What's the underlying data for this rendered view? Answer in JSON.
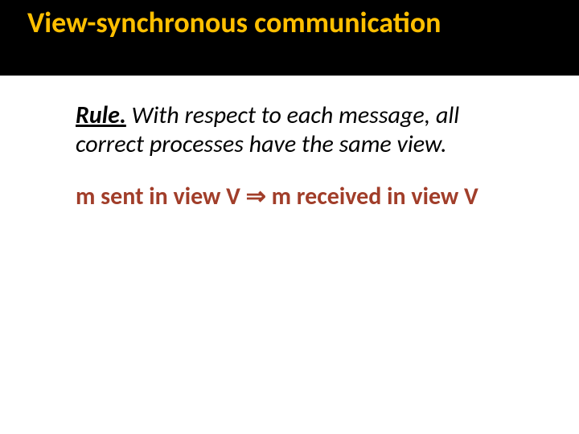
{
  "title": "View-synchronous communication",
  "rule": {
    "label": "Rule.",
    "text": " With respect to each message, all correct processes have the same view."
  },
  "implication": {
    "lhs": "m sent in view V ",
    "symbol": "⇒",
    "rhs": " m received in view V"
  }
}
